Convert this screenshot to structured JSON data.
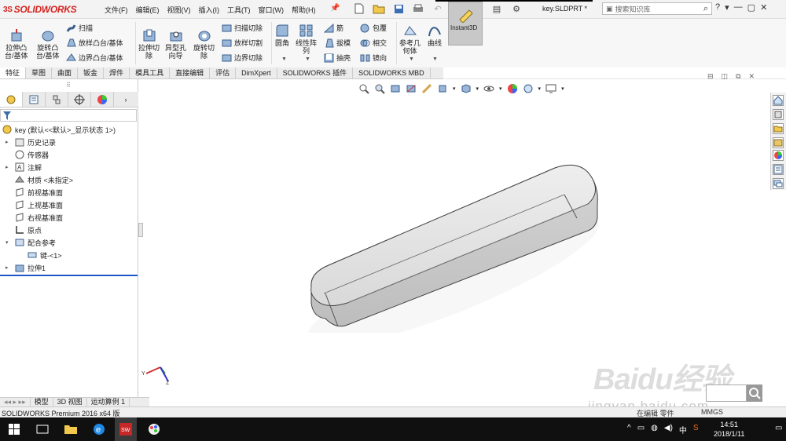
{
  "app": {
    "logo_text": "SOLIDWORKS",
    "logo_prefix": "3S",
    "brand_color": "#d5231f"
  },
  "menu": [
    "文件(F)",
    "编辑(E)",
    "视图(V)",
    "插入(I)",
    "工具(T)",
    "窗口(W)",
    "帮助(H)"
  ],
  "document_name": "key.SLDPRT *",
  "search": {
    "placeholder": "搜索知识库"
  },
  "window_controls": [
    "?",
    "▾",
    "—",
    "▢",
    "✕"
  ],
  "ribbon": {
    "extrude_boss": "拉伸凸\n台/基体",
    "revolve_boss": "旋转凸\n台/基体",
    "sweep": "扫描",
    "loft": "放样凸台/基体",
    "boundary": "边界凸台/基体",
    "extrude_cut": "拉伸切\n除",
    "hole_wizard": "异型孔\n向导",
    "revolve_cut": "旋转切\n除",
    "swept_cut": "扫描切除",
    "lofted_cut": "放样切割",
    "boundary_cut": "边界切除",
    "fillet": "圆角",
    "linear_pattern": "线性阵\n列",
    "rib": "筋",
    "draft": "拔模",
    "shell": "抽壳",
    "wrap": "包覆",
    "intersect": "相交",
    "mirror": "镜向",
    "ref_geometry": "参考几\n何体",
    "curves": "曲线",
    "instant3d": "Instant3D"
  },
  "command_tabs": [
    "特征",
    "草图",
    "曲面",
    "钣金",
    "焊件",
    "模具工具",
    "直接编辑",
    "评估",
    "DimXpert",
    "SOLIDWORKS 插件",
    "SOLIDWORKS MBD"
  ],
  "tree": {
    "root": "key  (默认<<默认>_显示状态 1>)",
    "items": [
      "历史记录",
      "传感器",
      "注解",
      "材质 <未指定>",
      "前视基准面",
      "上视基准面",
      "右视基准面",
      "原点",
      "配合参考",
      "键-<1>",
      "拉伸1"
    ]
  },
  "bottom_tabs": [
    "模型",
    "3D 视图",
    "运动算例 1"
  ],
  "status": {
    "product": "SOLIDWORKS Premium 2016 x64 版",
    "editing": "在编辑 零件",
    "units": "MMGS"
  },
  "taskbar": {
    "time": "14:51",
    "date": "2018/1/11",
    "ime": "中"
  },
  "watermark": {
    "main": "Baidu经验",
    "sub": "jingyan.baidu.com"
  }
}
